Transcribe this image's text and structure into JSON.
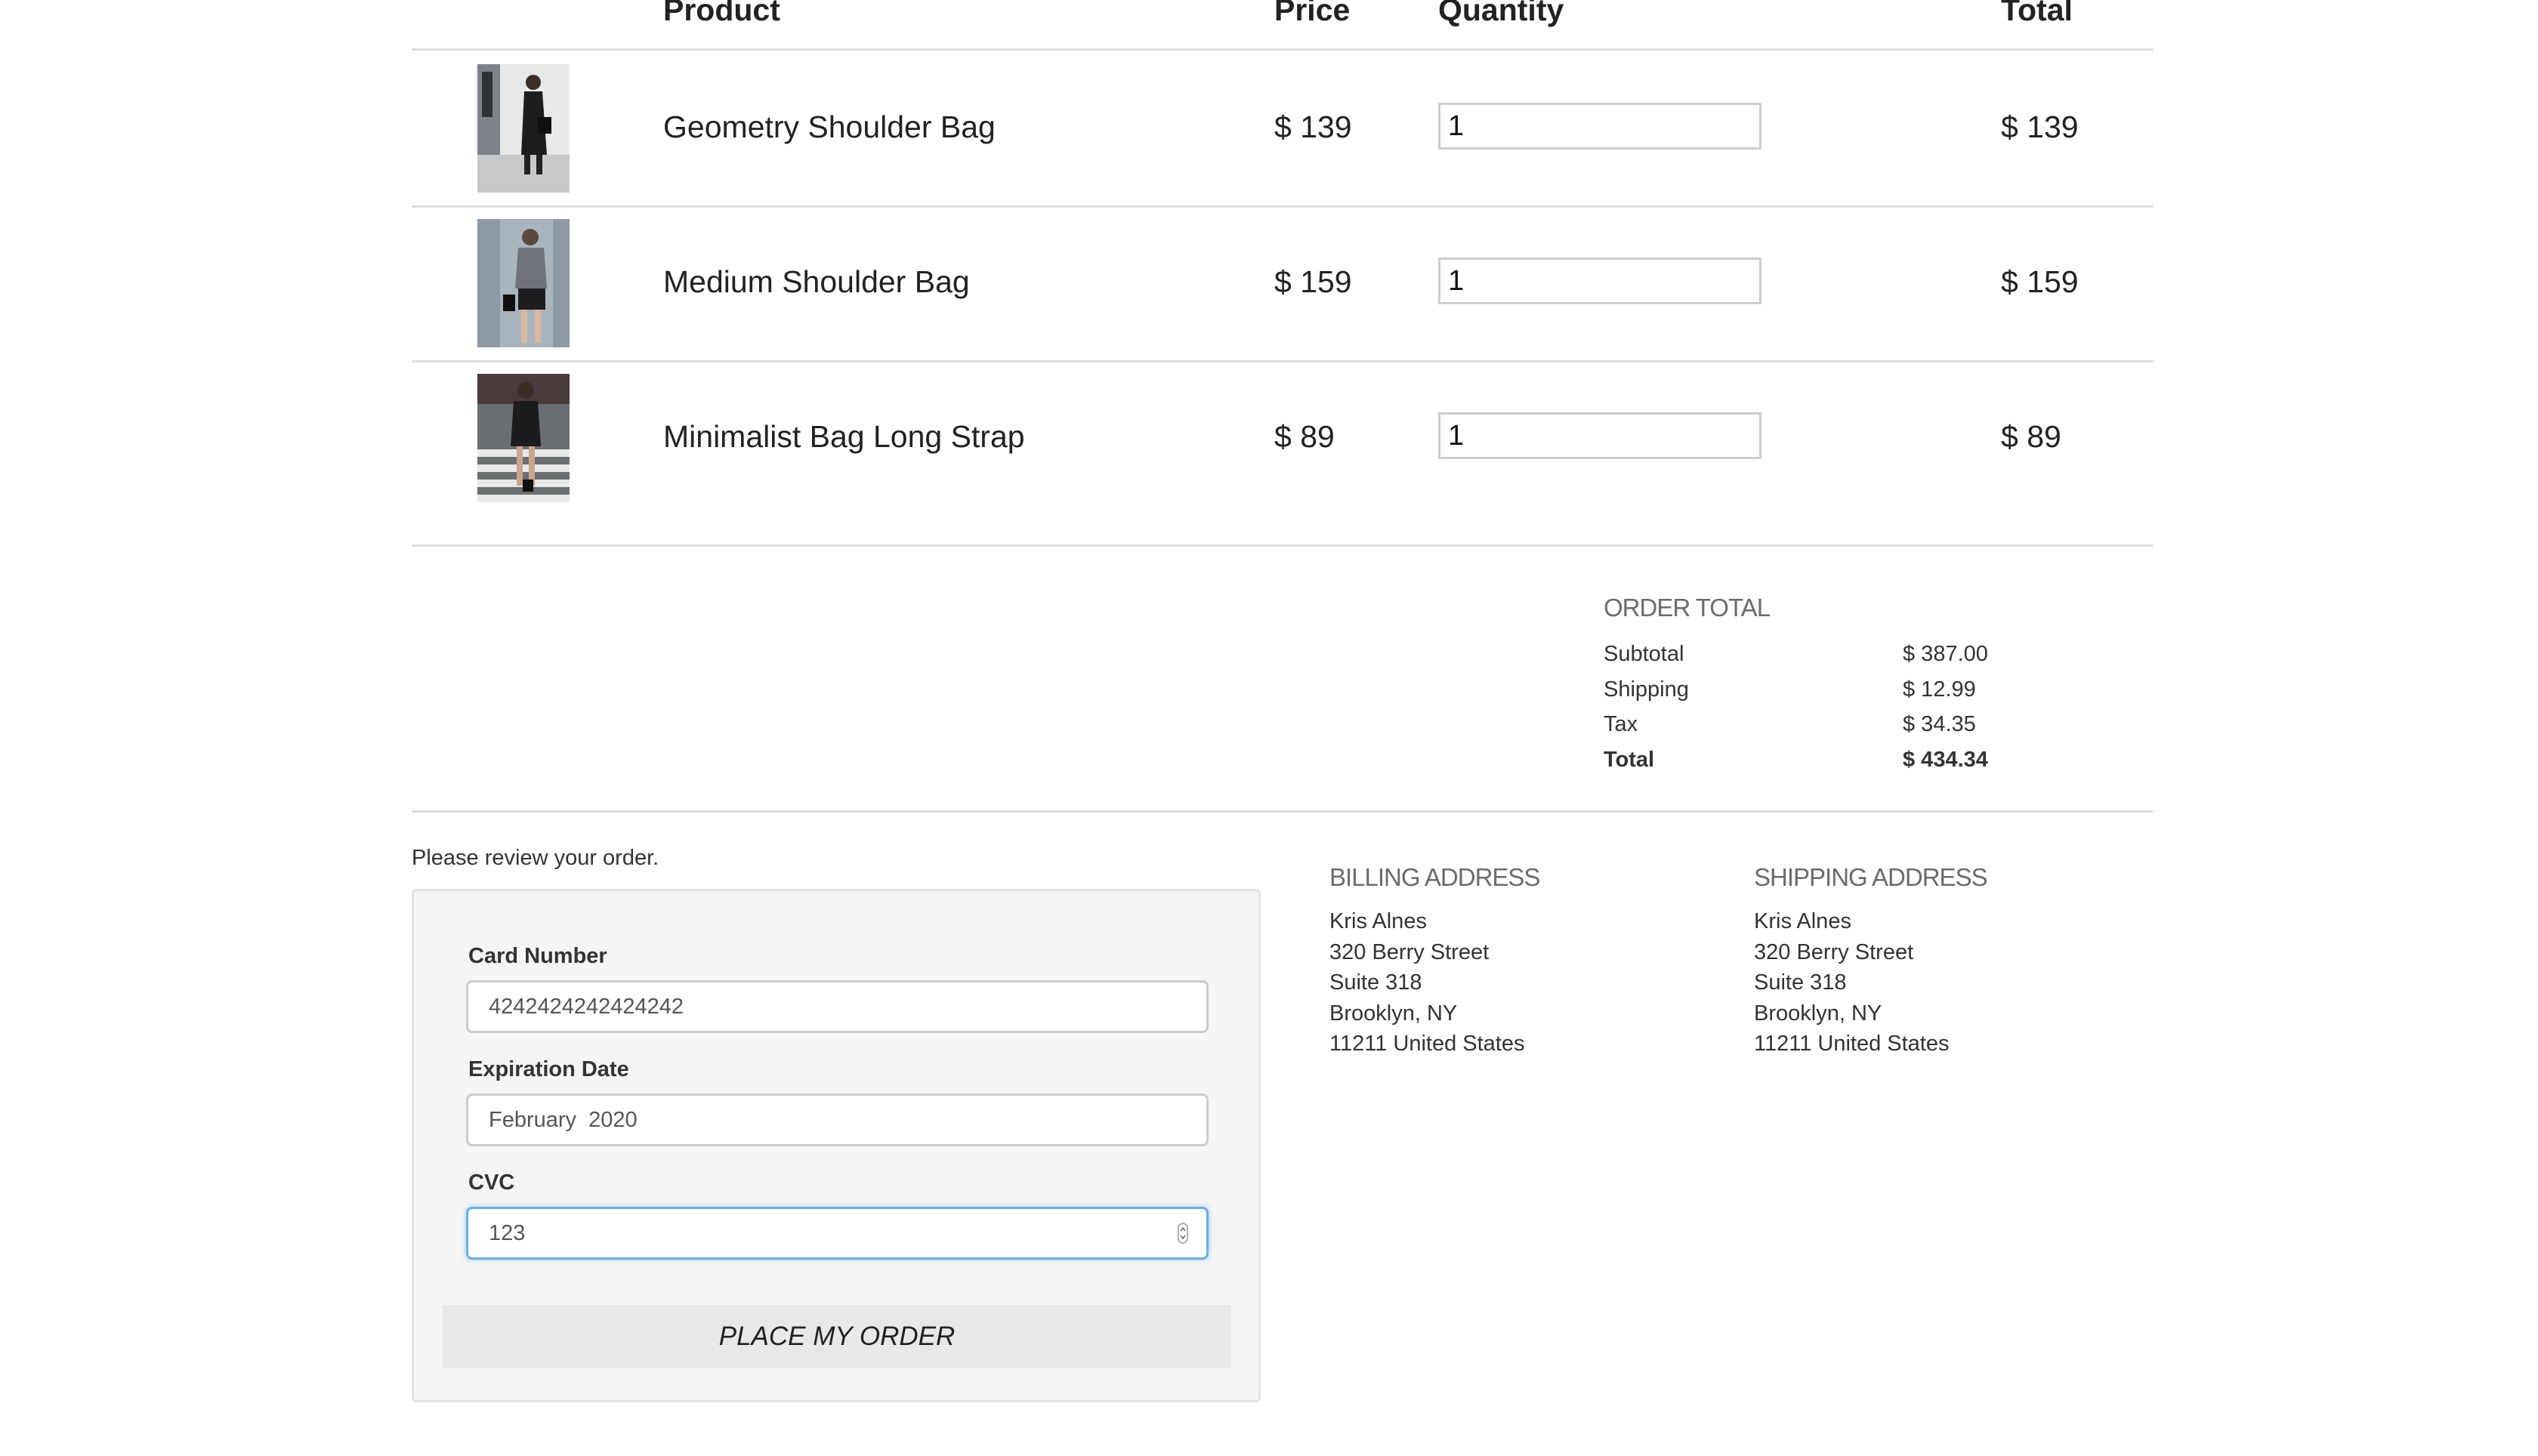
{
  "cart": {
    "headers": {
      "product": "Product",
      "price": "Price",
      "quantity": "Quantity",
      "total": "Total"
    },
    "items": [
      {
        "name": "Geometry Shoulder Bag",
        "price": "$ 139",
        "quantity": "1",
        "total": "$ 139"
      },
      {
        "name": "Medium Shoulder Bag",
        "price": "$ 159",
        "quantity": "1",
        "total": "$ 159"
      },
      {
        "name": "Minimalist Bag Long Strap",
        "price": "$ 89",
        "quantity": "1",
        "total": "$ 89"
      }
    ]
  },
  "order_total": {
    "title": "ORDER TOTAL",
    "rows": [
      {
        "label": "Subtotal",
        "value": "$ 387.00"
      },
      {
        "label": "Shipping",
        "value": "$ 12.99"
      },
      {
        "label": "Tax",
        "value": "$ 34.35"
      },
      {
        "label": "Total",
        "value": "$ 434.34"
      }
    ]
  },
  "review_text": "Please review your order.",
  "payment": {
    "card_number_label": "Card Number",
    "card_number_value": "4242424242424242",
    "expiration_label": "Expiration Date",
    "expiration_value": "February  2020",
    "cvc_label": "CVC",
    "cvc_value": "123",
    "submit_label": "PLACE MY ORDER"
  },
  "billing": {
    "title": "BILLING ADDRESS",
    "lines": [
      "Kris Alnes",
      "320 Berry Street",
      "Suite 318",
      "Brooklyn, NY",
      "11211 United States"
    ]
  },
  "shipping": {
    "title": "SHIPPING ADDRESS",
    "lines": [
      "Kris Alnes",
      "320 Berry Street",
      "Suite 318",
      "Brooklyn, NY",
      "11211 United States"
    ]
  },
  "colors": {
    "focus_border": "#66afe9",
    "button_bg": "#e8e8ea",
    "panel_bg": "#f5f5f5"
  }
}
